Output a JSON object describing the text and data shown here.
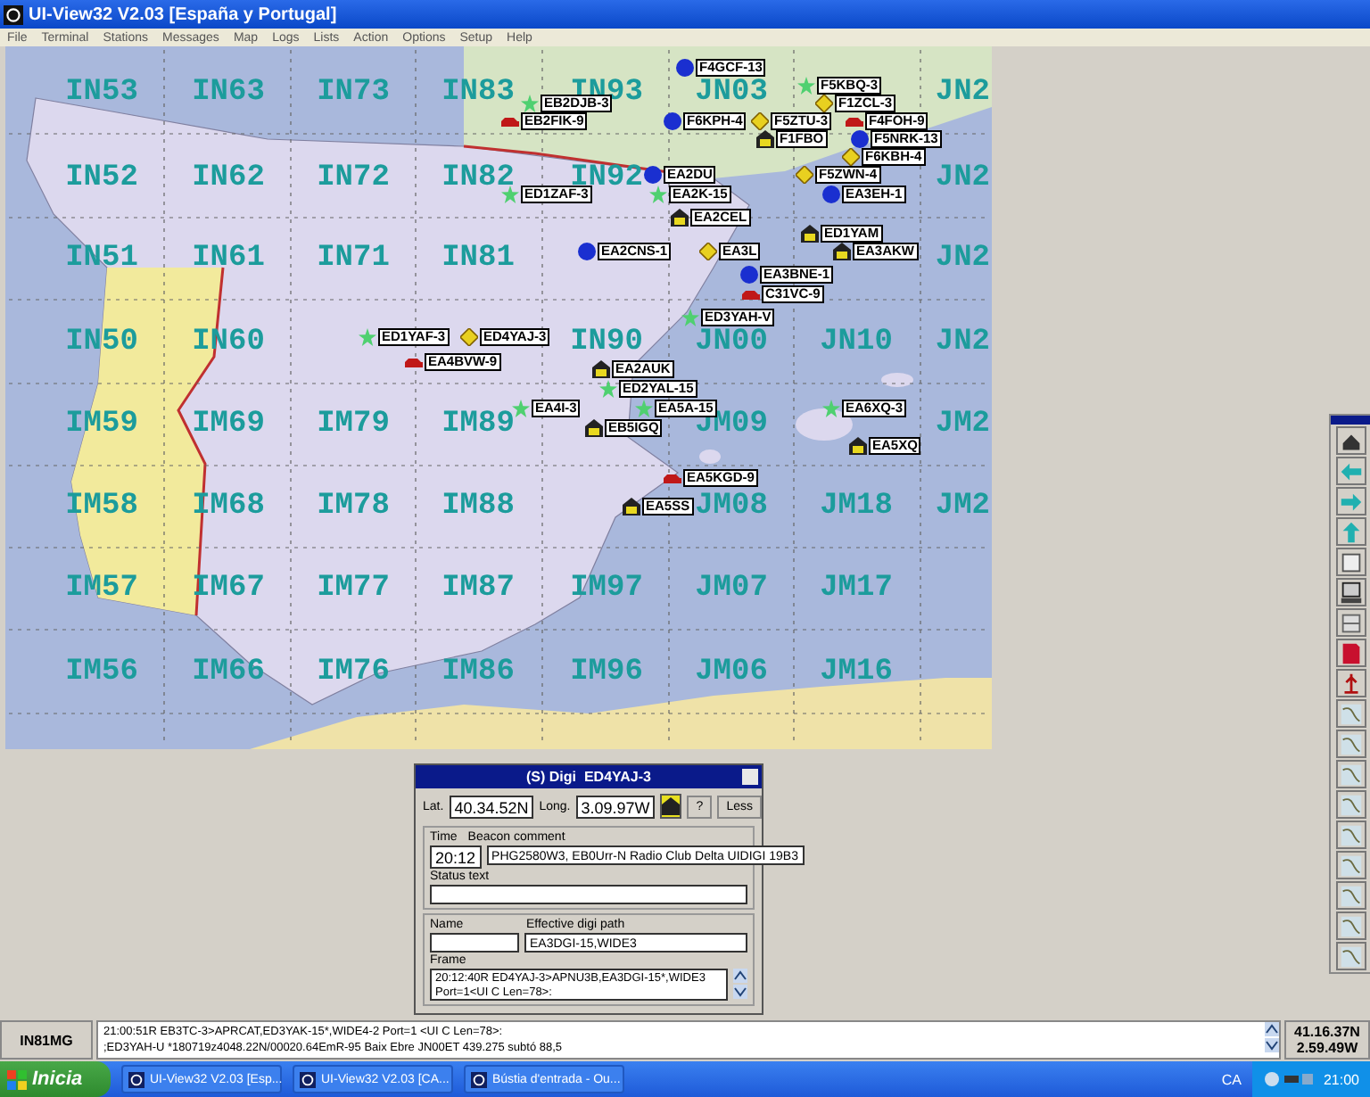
{
  "window": {
    "title": "UI-View32 V2.03 [España y Portugal]"
  },
  "menu": [
    "File",
    "Terminal",
    "Stations",
    "Messages",
    "Map",
    "Logs",
    "Lists",
    "Action",
    "Options",
    "Setup",
    "Help"
  ],
  "map": {
    "grid": [
      [
        "IN53",
        "IN63",
        "IN73",
        "IN83",
        "IN93",
        "JN03",
        "JN2"
      ],
      [
        "IN52",
        "IN62",
        "IN72",
        "IN82",
        "IN92",
        "JN2"
      ],
      [
        "IN51",
        "IN61",
        "IN71",
        "IN81",
        "JN2"
      ],
      [
        "IN50",
        "IN60",
        "IN90",
        "JN00",
        "JN10",
        "JN2"
      ],
      [
        "IM59",
        "IM69",
        "IM79",
        "IM89",
        "JM09",
        "JM2"
      ],
      [
        "IM58",
        "IM68",
        "IM78",
        "IM88",
        "JM08",
        "JM18",
        "JM2"
      ],
      [
        "IM57",
        "IM67",
        "IM77",
        "IM87",
        "IM97",
        "JM07",
        "JM17"
      ],
      [
        "IM56",
        "IM66",
        "IM76",
        "IM86",
        "IM96",
        "JM06",
        "JM16"
      ]
    ],
    "stations": [
      {
        "call": "F4GCF-13",
        "kind": "wx"
      },
      {
        "call": "F5KBQ-3",
        "kind": "star"
      },
      {
        "call": "EB2DJB-3",
        "kind": "star"
      },
      {
        "call": "F1ZCL-3",
        "kind": "diamond"
      },
      {
        "call": "EB2FIK-9",
        "kind": "car"
      },
      {
        "call": "F6KPH-4",
        "kind": "wx"
      },
      {
        "call": "F5ZTU-3",
        "kind": "diamond"
      },
      {
        "call": "F4FOH-9",
        "kind": "car"
      },
      {
        "call": "F1FBO",
        "kind": "digi"
      },
      {
        "call": "F5NRK-13",
        "kind": "wx"
      },
      {
        "call": "F6KBH-4",
        "kind": "diamond"
      },
      {
        "call": "EA2DU",
        "kind": "wx"
      },
      {
        "call": "F5ZWN-4",
        "kind": "diamond"
      },
      {
        "call": "ED1ZAF-3",
        "kind": "star"
      },
      {
        "call": "EA2K-15",
        "kind": "star"
      },
      {
        "call": "EA3EH-1",
        "kind": "wx"
      },
      {
        "call": "EA2CEL",
        "kind": "digi"
      },
      {
        "call": "ED1YAM",
        "kind": "digi"
      },
      {
        "call": "EA2CNS-1",
        "kind": "wx"
      },
      {
        "call": "EA3L",
        "kind": "diamond"
      },
      {
        "call": "EA3AKW",
        "kind": "digi"
      },
      {
        "call": "EA3BNE-1",
        "kind": "wx"
      },
      {
        "call": "C31VC-9",
        "kind": "car"
      },
      {
        "call": "ED3YAH-V",
        "kind": "star"
      },
      {
        "call": "ED1YAF-3",
        "kind": "star"
      },
      {
        "call": "ED4YAJ-3",
        "kind": "diamond"
      },
      {
        "call": "EA4BVW-9",
        "kind": "car"
      },
      {
        "call": "EA2AUK",
        "kind": "digi"
      },
      {
        "call": "ED2YAL-15",
        "kind": "star"
      },
      {
        "call": "EA4I-3",
        "kind": "star"
      },
      {
        "call": "EA5A-15",
        "kind": "star"
      },
      {
        "call": "EA6XQ-3",
        "kind": "star"
      },
      {
        "call": "EB5IGQ",
        "kind": "digi"
      },
      {
        "call": "EA5XQ",
        "kind": "digi"
      },
      {
        "call": "EA5KGD-9",
        "kind": "car"
      },
      {
        "call": "EA5SS",
        "kind": "digi"
      }
    ]
  },
  "station_dialog": {
    "title": "(S) Digi  ED4YAJ-3",
    "lat_label": "Lat.",
    "lat": "40.34.52N",
    "long_label": "Long.",
    "long": "3.09.97W",
    "help_button": "?",
    "less_button": "Less",
    "time_label": "Time",
    "time": "20:12",
    "comment_label": "Beacon comment",
    "comment": "PHG2580W3, EB0Urr-N Radio Club Delta UIDIGI 19B3",
    "status_label": "Status text",
    "name_label": "Name",
    "path_label": "Effective digi path",
    "path": "EA3DGI-15,WIDE3",
    "frame_label": "Frame",
    "frame": "20:12:40R ED4YAJ-3>APNU3B,EA3DGI-15*,WIDE3 Port=1<UI C Len=78>:"
  },
  "status_bar": {
    "locator": "IN81MG",
    "log": [
      "21:00:51R EB3TC-3>APRCAT,ED3YAK-15*,WIDE4-2 Port=1 <UI C Len=78>:",
      ";ED3YAH-U *180719z4048.22N/00020.64EmR-95 Baix Ebre JN00ET 439.275 subtó 88,5"
    ],
    "lat": "41.16.37N",
    "long": "2.59.49W"
  },
  "taskbar": {
    "start": "Inicia",
    "tasks": [
      "UI-View32 V2.03 [Esp...",
      "UI-View32 V2.03 [CA...",
      "Bústia d'entrada - Ou..."
    ],
    "language": "CA",
    "clock": "21:00"
  }
}
